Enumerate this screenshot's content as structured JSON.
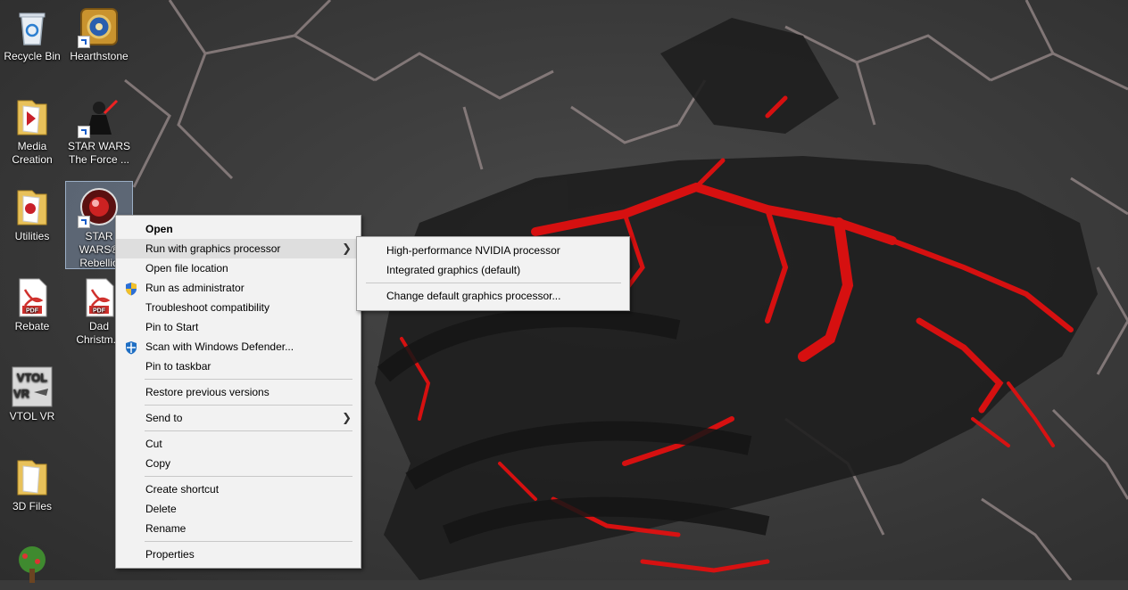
{
  "desktop_icons": [
    {
      "label": "Recycle Bin",
      "icon": "recycle-bin-icon"
    },
    {
      "label": "Hearthstone",
      "icon": "hearthstone-icon"
    },
    {
      "label": "Media Creation",
      "icon": "folder-icon"
    },
    {
      "label": "STAR WARS The Force ...",
      "icon": "star-wars-force-icon"
    },
    {
      "label": "Utilities",
      "icon": "folder-icon"
    },
    {
      "label": "STAR WARS® Rebellio",
      "icon": "star-wars-rebellion-icon"
    },
    {
      "label": "Rebate",
      "icon": "pdf-icon"
    },
    {
      "label": "Dad Christm...",
      "icon": "pdf-icon"
    },
    {
      "label": "VTOL VR",
      "icon": "vtol-vr-icon"
    },
    {
      "label": "3D Files",
      "icon": "folder-icon"
    },
    {
      "label": "",
      "icon": "tree-app-icon"
    }
  ],
  "context_menu": {
    "items": [
      {
        "label": "Open"
      },
      {
        "label": "Run with graphics processor"
      },
      {
        "label": "Open file location"
      },
      {
        "label": "Run as administrator",
        "icon": "uac-shield-icon"
      },
      {
        "label": "Troubleshoot compatibility"
      },
      {
        "label": "Pin to Start"
      },
      {
        "label": "Scan with Windows Defender...",
        "icon": "windows-defender-icon"
      },
      {
        "label": "Pin to taskbar"
      },
      {
        "label": "Restore previous versions"
      },
      {
        "label": "Send to"
      },
      {
        "label": "Cut"
      },
      {
        "label": "Copy"
      },
      {
        "label": "Create shortcut"
      },
      {
        "label": "Delete"
      },
      {
        "label": "Rename"
      },
      {
        "label": "Properties"
      }
    ]
  },
  "submenu": {
    "items": [
      {
        "label": "High-performance NVIDIA processor"
      },
      {
        "label": "Integrated graphics (default)"
      },
      {
        "label": "Change default graphics processor..."
      }
    ]
  },
  "colors": {
    "accent_red": "#e01010",
    "menu_bg": "#f2f2f2",
    "menu_highlight": "#dedede",
    "selection": "#a0bee6"
  }
}
